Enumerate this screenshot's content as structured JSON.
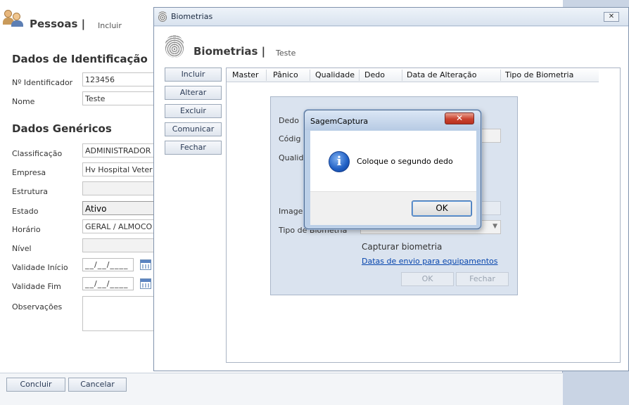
{
  "pessoas": {
    "title": "Pessoas |",
    "subtitle": "Incluir",
    "section_identificacao": "Dados de Identificação",
    "section_genericos": "Dados Genéricos",
    "labels": {
      "identificador": "Nº Identificador",
      "nome": "Nome",
      "classificacao": "Classificação",
      "empresa": "Empresa",
      "estrutura": "Estrutura",
      "estado": "Estado",
      "horario": "Horário",
      "nivel": "Nível",
      "validade_inicio": "Validade Início",
      "validade_fim": "Validade Fim",
      "observacoes": "Observações"
    },
    "values": {
      "identificador": "123456",
      "nome": "Teste",
      "classificacao": "ADMINISTRADOR",
      "empresa": "Hv Hospital Veter",
      "estado": "Ativo",
      "horario": "GERAL / ALMOCO",
      "validade_inicio": "__/__/____",
      "validade_fim": "__/__/____"
    },
    "buttons": {
      "concluir": "Concluir",
      "cancelar": "Cancelar"
    }
  },
  "biometrias": {
    "window_title": "Biometrias",
    "close": "✕",
    "title": "Biometrias |",
    "subtitle": "Teste",
    "side_buttons": [
      "Incluir",
      "Alterar",
      "Excluir",
      "Comunicar",
      "Fechar"
    ],
    "columns": [
      "Master",
      "Pânico",
      "Qualidade",
      "Dedo",
      "Data de Alteração",
      "Tipo de Biometria"
    ],
    "panel": {
      "dedo": "Dedo",
      "codigo": "Códig",
      "qualidade": "Qualid",
      "imagem": "Image",
      "tipo": "Tipo de Biometria",
      "capturar": "Capturar biometria",
      "datas_link": "Datas de envio para equipamentos",
      "ok": "OK",
      "fechar": "Fechar"
    }
  },
  "dialog": {
    "title": "SagemCaptura",
    "close": "✕",
    "message": "Coloque o segundo dedo",
    "info_glyph": "i",
    "ok": "OK"
  }
}
